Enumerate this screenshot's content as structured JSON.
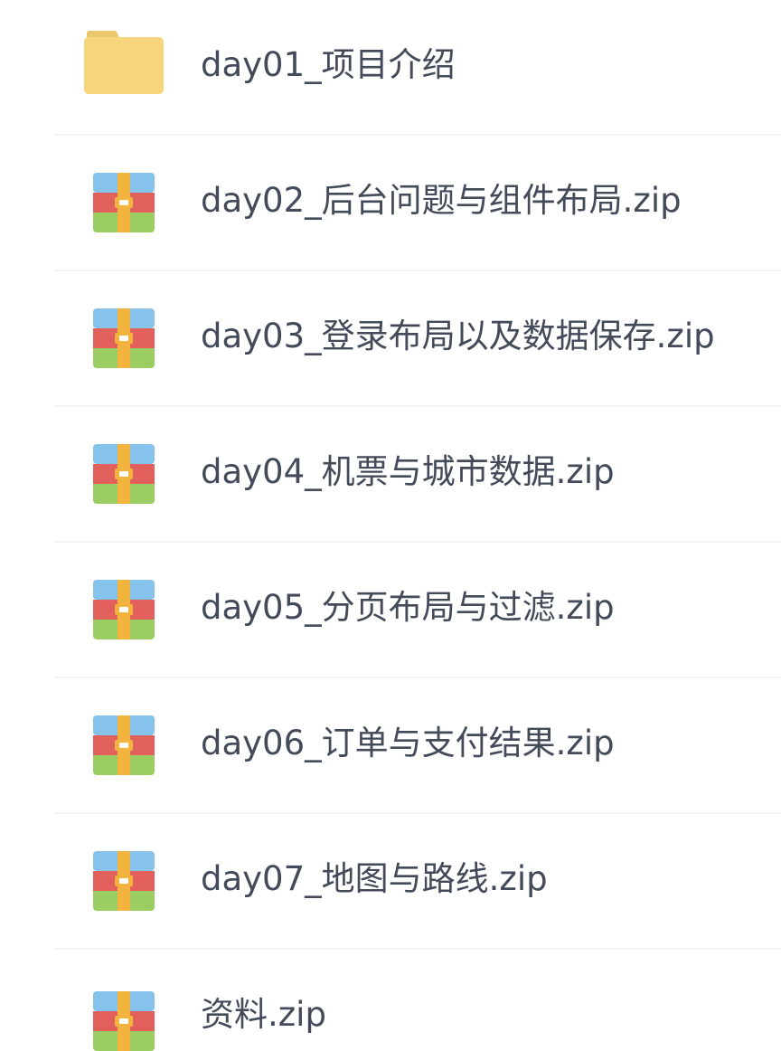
{
  "files": [
    {
      "name": "day01_项目介绍",
      "type": "folder",
      "icon": "folder-icon"
    },
    {
      "name": "day02_后台问题与组件布局.zip",
      "type": "zip",
      "icon": "zip-archive-icon"
    },
    {
      "name": "day03_登录布局以及数据保存.zip",
      "type": "zip",
      "icon": "zip-archive-icon"
    },
    {
      "name": "day04_机票与城市数据.zip",
      "type": "zip",
      "icon": "zip-archive-icon"
    },
    {
      "name": "day05_分页布局与过滤.zip",
      "type": "zip",
      "icon": "zip-archive-icon"
    },
    {
      "name": "day06_订单与支付结果.zip",
      "type": "zip",
      "icon": "zip-archive-icon"
    },
    {
      "name": "day07_地图与路线.zip",
      "type": "zip",
      "icon": "zip-archive-icon"
    },
    {
      "name": "资料.zip",
      "type": "zip",
      "icon": "zip-archive-icon"
    }
  ],
  "colors": {
    "folder_body": "#f6d57c",
    "folder_tab": "#e9c76a",
    "zip_top": "#86c3ec",
    "zip_middle": "#e2605c",
    "zip_bottom": "#9bcd63",
    "zip_strap": "#f2b33f",
    "text": "#434a59",
    "divider": "#f1f3f6"
  }
}
